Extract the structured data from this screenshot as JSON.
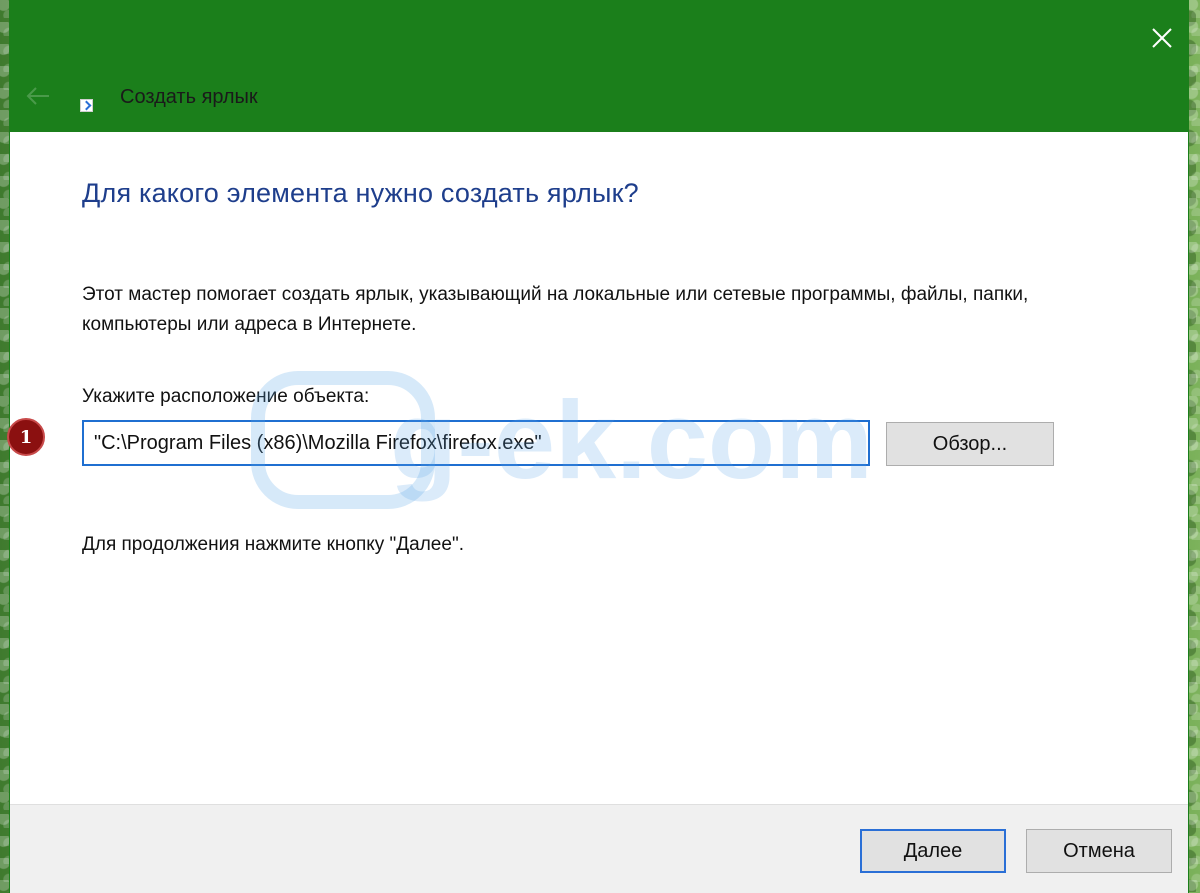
{
  "window": {
    "title": "Создать ярлык",
    "back_icon": "back-arrow-icon",
    "close_icon": "close-icon",
    "title_color": "#1b7f1b"
  },
  "main": {
    "heading": "Для какого элемента нужно создать ярлык?",
    "description": "Этот мастер помогает создать ярлык, указывающий на локальные или сетевые программы, файлы, папки, компьютеры или адреса в Интернете.",
    "location_label": "Укажите расположение объекта:",
    "location_value": "\"C:\\Program Files (x86)\\Mozilla Firefox\\firefox.exe\"",
    "browse_label": "Обзор...",
    "hint": "Для продолжения нажмите кнопку \"Далее\".",
    "step_marker": "1"
  },
  "watermark": {
    "text": "g-ek.com"
  },
  "footer": {
    "next_label": "Далее",
    "cancel_label": "Отмена"
  }
}
